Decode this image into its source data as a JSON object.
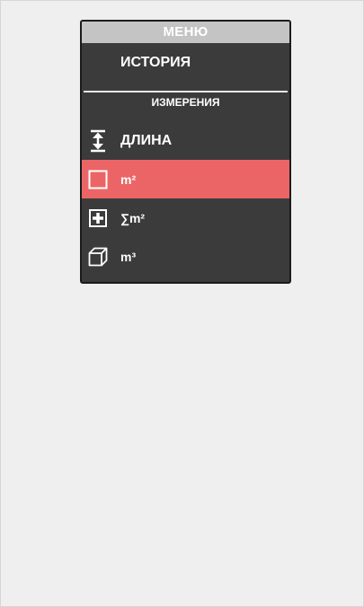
{
  "menu": {
    "title": "МЕНЮ",
    "history_label": "ИСТОРИЯ",
    "section_title": "ИЗМЕРЕНИЯ",
    "items": [
      {
        "label": "ДЛИНА",
        "icon": "length-arrows-icon",
        "active": false
      },
      {
        "label": "m²",
        "icon": "square-icon",
        "active": true
      },
      {
        "label": "∑m²",
        "icon": "plus-box-icon",
        "active": false
      },
      {
        "label": "m³",
        "icon": "cube-icon",
        "active": false
      }
    ]
  },
  "colors": {
    "background": "#efefef",
    "menu_background": "#3b3b3b",
    "header_background": "#c4c4c4",
    "active_item": "#ec6566",
    "text": "#ffffff"
  }
}
